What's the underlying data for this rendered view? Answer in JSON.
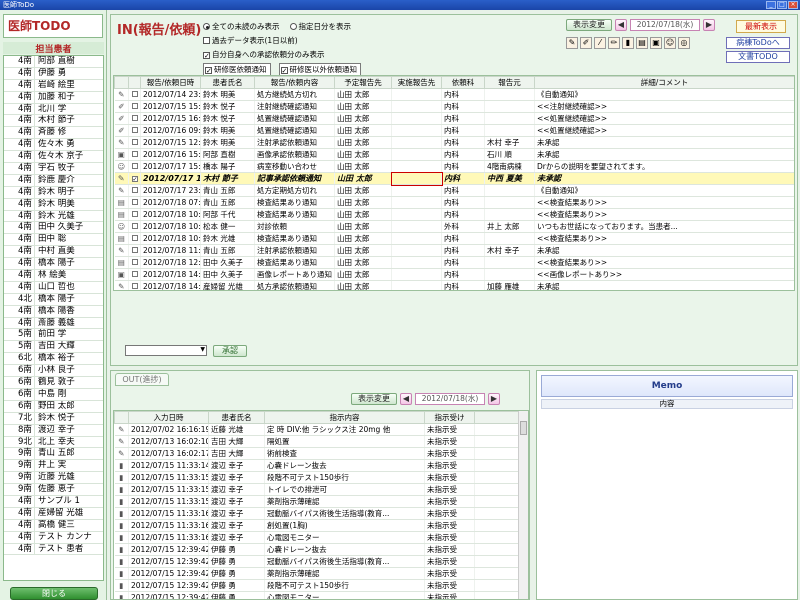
{
  "window": {
    "title": "医師ToDo"
  },
  "sidebar": {
    "app_title": "医師TODO",
    "patient_header": "担当患者",
    "close_label": "閉じる",
    "patients": [
      {
        "ward": "4南",
        "name": "阿部 直樹"
      },
      {
        "ward": "4南",
        "name": "伊藤 勇"
      },
      {
        "ward": "4南",
        "name": "岩崎 絵里"
      },
      {
        "ward": "4南",
        "name": "加藤 和子"
      },
      {
        "ward": "4南",
        "name": "北川 学"
      },
      {
        "ward": "4南",
        "name": "木村 節子"
      },
      {
        "ward": "4南",
        "name": "斉藤 修"
      },
      {
        "ward": "4南",
        "name": "佐々木 勇"
      },
      {
        "ward": "4南",
        "name": "佐々木 京子"
      },
      {
        "ward": "4南",
        "name": "宇石 牧子"
      },
      {
        "ward": "4南",
        "name": "鈴鹿 慶介"
      },
      {
        "ward": "4南",
        "name": "鈴木 明子"
      },
      {
        "ward": "4南",
        "name": "鈴木 明美"
      },
      {
        "ward": "4南",
        "name": "鈴木 光雄"
      },
      {
        "ward": "4南",
        "name": "田中 久美子"
      },
      {
        "ward": "4南",
        "name": "田中 聡"
      },
      {
        "ward": "4南",
        "name": "中村 直美"
      },
      {
        "ward": "4南",
        "name": "橋本 陽子"
      },
      {
        "ward": "4南",
        "name": "林 絵美"
      },
      {
        "ward": "4南",
        "name": "山口 哲也"
      },
      {
        "ward": "4北",
        "name": "橋本 陽子"
      },
      {
        "ward": "4南",
        "name": "橋本 陽香"
      },
      {
        "ward": "4南",
        "name": "斎藤 義雄"
      },
      {
        "ward": "5南",
        "name": "前田 学"
      },
      {
        "ward": "5南",
        "name": "吉田 大輝"
      },
      {
        "ward": "6北",
        "name": "橋本 裕子"
      },
      {
        "ward": "6南",
        "name": "小林 良子"
      },
      {
        "ward": "6南",
        "name": "鶴見 敦子"
      },
      {
        "ward": "6南",
        "name": "中島 剛"
      },
      {
        "ward": "6南",
        "name": "野田 太郎"
      },
      {
        "ward": "7北",
        "name": "鈴木 悦子"
      },
      {
        "ward": "8南",
        "name": "渡辺 幸子"
      },
      {
        "ward": "9北",
        "name": "北上 幸夫"
      },
      {
        "ward": "9南",
        "name": "青山 五郎"
      },
      {
        "ward": "9南",
        "name": "井上 実"
      },
      {
        "ward": "9南",
        "name": "近藤 光雄"
      },
      {
        "ward": "9南",
        "name": "佐藤 恵子"
      },
      {
        "ward": "4南",
        "name": "サンプル 1"
      },
      {
        "ward": "4南",
        "name": "産婦留 光雄"
      },
      {
        "ward": "4南",
        "name": "高橋 健三"
      },
      {
        "ward": "4南",
        "name": "テスト カンナ"
      },
      {
        "ward": "4南",
        "name": "テスト 患者"
      }
    ]
  },
  "in_panel": {
    "title": "IN(報告/依頼)",
    "radio_all": "全ての未読のみ表示",
    "radio_date": "指定日分を表示",
    "opt_past": "過去データ表示(1日以前)",
    "opt_self": "自分自身への承認依頼分のみ表示",
    "opt_doctor": "研修医依頼通知",
    "opt_other": "研修医以外依頼通知",
    "display_change": "表示変更",
    "date": "2012/07/18(水)",
    "latest": "最新表示",
    "ward_todo": "病棟ToDoへ",
    "doc_todo": "文書TODO",
    "approve_label": "承認",
    "columns": [
      "報告/依頼日時",
      "患者氏名",
      "報告/依頼内容",
      "予定報告先",
      "実施報告先",
      "依頼科",
      "報告元",
      "詳細/コメント"
    ],
    "rows": [
      {
        "dt": "2012/07/14 23:59",
        "pt": "鈴木 明美",
        "content": "処方継続処方切れ",
        "plan": "山田 太郎",
        "done": "",
        "dept": "内科",
        "src": "",
        "detail": "《自動通知》"
      },
      {
        "dt": "2012/07/15 15:00",
        "pt": "鈴木 悦子",
        "content": "注射継続確認通知",
        "plan": "山田 太郎",
        "done": "",
        "dept": "内科",
        "src": "",
        "detail": "<<注射継続確認>>"
      },
      {
        "dt": "2012/07/15 16:10",
        "pt": "鈴木 悦子",
        "content": "処置継続確認通知",
        "plan": "山田 太郎",
        "done": "",
        "dept": "内科",
        "src": "",
        "detail": "<<処置継続確認>>"
      },
      {
        "dt": "2012/07/16 09:00",
        "pt": "鈴木 明美",
        "content": "処置継続確認通知",
        "plan": "山田 太郎",
        "done": "",
        "dept": "内科",
        "src": "",
        "detail": "<<処置継続確認>>"
      },
      {
        "dt": "2012/07/15 12:23",
        "pt": "鈴木 明美",
        "content": "注射承認依頼通知",
        "plan": "山田 太郎",
        "done": "",
        "dept": "内科",
        "src": "木村 幸子",
        "detail": "未承認"
      },
      {
        "dt": "2012/07/16 15:09",
        "pt": "阿部 直樹",
        "content": "画像承認依頼通知",
        "plan": "山田 太郎",
        "done": "",
        "dept": "内科",
        "src": "石川 順",
        "detail": "未承認"
      },
      {
        "dt": "2012/07/17 15:01",
        "pt": "橋本 陽子",
        "content": "病室移動い合わせ",
        "plan": "山田 太郎",
        "done": "",
        "dept": "内科",
        "src": "4階南病棟",
        "detail": "Drからの説明を要望されてます。"
      },
      {
        "dt": "2012/07/17 1...",
        "pt": "木村 節子",
        "content": "記事承認依頼通知",
        "plan": "山田 太郎",
        "done": "",
        "dept": "内科",
        "src": "中西 夏美",
        "detail": "未承認"
      },
      {
        "dt": "2012/07/17 23:59",
        "pt": "青山 五郎",
        "content": "処方定期処方切れ",
        "plan": "山田 太郎",
        "done": "",
        "dept": "内科",
        "src": "",
        "detail": "《自動通知》"
      },
      {
        "dt": "2012/07/18 07:03",
        "pt": "青山 五郎",
        "content": "検査結果あり通知",
        "plan": "山田 太郎",
        "done": "",
        "dept": "内科",
        "src": "",
        "detail": "<<検査結果あり>>"
      },
      {
        "dt": "2012/07/18 10:19",
        "pt": "阿部 千代",
        "content": "検査結果あり通知",
        "plan": "山田 太郎",
        "done": "",
        "dept": "内科",
        "src": "",
        "detail": "<<検査結果あり>>"
      },
      {
        "dt": "2012/07/18 10:28",
        "pt": "松本 健一",
        "content": "対診依頼",
        "plan": "山田 太郎",
        "done": "",
        "dept": "外科",
        "src": "井上 太郎",
        "detail": "いつもお世話になっております。当患者..."
      },
      {
        "dt": "2012/07/18 10:58",
        "pt": "鈴木 光雄",
        "content": "検査結果あり通知",
        "plan": "山田 太郎",
        "done": "",
        "dept": "内科",
        "src": "",
        "detail": "<<検査結果あり>>"
      },
      {
        "dt": "2012/07/18 11:04",
        "pt": "青山 五郎",
        "content": "注射承認依頼通知",
        "plan": "山田 太郎",
        "done": "",
        "dept": "内科",
        "src": "木村 幸子",
        "detail": "未承認"
      },
      {
        "dt": "2012/07/18 12:17",
        "pt": "田中 久美子",
        "content": "検査結果あり通知",
        "plan": "山田 太郎",
        "done": "",
        "dept": "内科",
        "src": "",
        "detail": "<<検査結果あり>>"
      },
      {
        "dt": "2012/07/18 14:16",
        "pt": "田中 久美子",
        "content": "画像レポートあり通知",
        "plan": "山田 太郎",
        "done": "",
        "dept": "内科",
        "src": "",
        "detail": "<<画像レポートあり>>"
      },
      {
        "dt": "2012/07/18 14:45",
        "pt": "産婦留 光雄",
        "content": "処方承認依頼通知",
        "plan": "山田 太郎",
        "done": "",
        "dept": "内科",
        "src": "加藤 雁雄",
        "detail": "未承認"
      }
    ]
  },
  "out_panel": {
    "tab_label": "OUT(進捗)",
    "display_change": "表示変更",
    "date": "2012/07/18(水)",
    "columns": [
      "入力日時",
      "患者氏名",
      "指示内容",
      "指示受け"
    ],
    "rows": [
      {
        "dt": "2012/07/02 16:16:19",
        "pt": "近藤 光雄",
        "content": "定 時 DIV:他 ラシックス注 20mg 他",
        "status": "未指示受"
      },
      {
        "dt": "2012/07/13 16:02:10",
        "pt": "吉田 大輝",
        "content": "隔処置",
        "status": "未指示受"
      },
      {
        "dt": "2012/07/13 16:02:17",
        "pt": "吉田 大輝",
        "content": "術前検査",
        "status": "未指示受"
      },
      {
        "dt": "2012/07/15 11:33:14",
        "pt": "渡辺 幸子",
        "content": "心嚢ドレーン抜去",
        "status": "未指示受"
      },
      {
        "dt": "2012/07/15 11:33:15",
        "pt": "渡辺 幸子",
        "content": "段階不可テスト150歩行",
        "status": "未指示受"
      },
      {
        "dt": "2012/07/15 11:33:15",
        "pt": "渡辺 幸子",
        "content": "トイレでの排泄可",
        "status": "未指示受"
      },
      {
        "dt": "2012/07/15 11:33:15",
        "pt": "渡辺 幸子",
        "content": "薬剤指示薄確認",
        "status": "未指示受"
      },
      {
        "dt": "2012/07/15 11:33:16",
        "pt": "渡辺 幸子",
        "content": "冠動脈バイパス術後生活指導(教育...",
        "status": "未指示受"
      },
      {
        "dt": "2012/07/15 11:33:16",
        "pt": "渡辺 幸子",
        "content": "創処置(1胸)",
        "status": "未指示受"
      },
      {
        "dt": "2012/07/15 11:33:16",
        "pt": "渡辺 幸子",
        "content": "心電図モニター",
        "status": "未指示受"
      },
      {
        "dt": "2012/07/15 12:39:42",
        "pt": "伊藤 勇",
        "content": "心嚢ドレーン抜去",
        "status": "未指示受"
      },
      {
        "dt": "2012/07/15 12:39:42",
        "pt": "伊藤 勇",
        "content": "冠動脈バイパス術後生活指導(教育...",
        "status": "未指示受"
      },
      {
        "dt": "2012/07/15 12:39:42",
        "pt": "伊藤 勇",
        "content": "薬剤指示薄確認",
        "status": "未指示受"
      },
      {
        "dt": "2012/07/15 12:39:42",
        "pt": "伊藤 勇",
        "content": "段階不可テスト150歩行",
        "status": "未指示受"
      },
      {
        "dt": "2012/07/15 12:39:42",
        "pt": "伊藤 勇",
        "content": "心電図モニター",
        "status": "未指示受"
      }
    ]
  },
  "memo": {
    "title": "Memo",
    "column": "内容"
  }
}
